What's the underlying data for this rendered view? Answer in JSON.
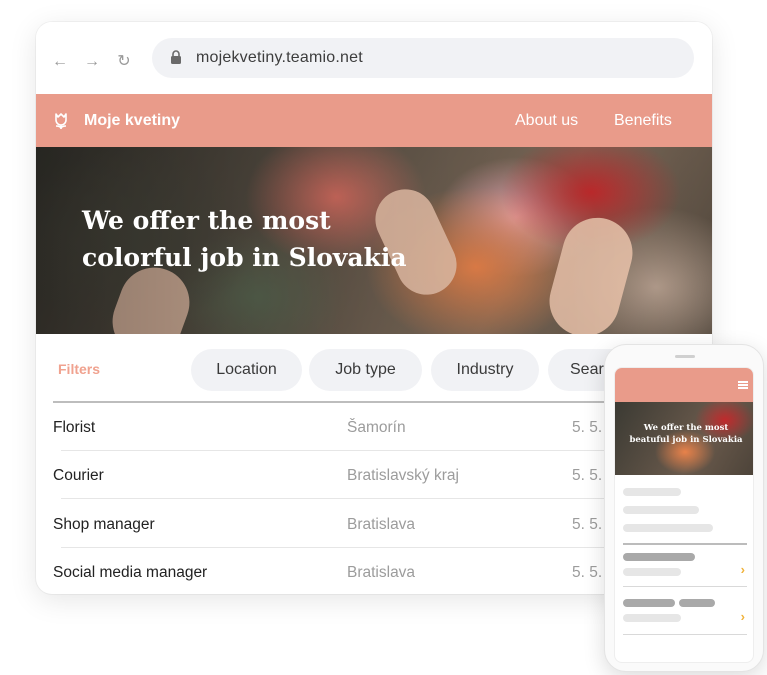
{
  "browser": {
    "url": "mojekvetiny.teamio.net",
    "icons": [
      "back-arrow-icon",
      "forward-arrow-icon",
      "reload-icon",
      "lock-icon"
    ]
  },
  "site": {
    "brand": "Moje kvetiny",
    "menu": [
      "About us",
      "Benefits"
    ],
    "hero_title_line1": "We offer the most",
    "hero_title_line2": "colorful job in Slovakia",
    "accent_color": "#e99b8a"
  },
  "filters": {
    "label": "Filters",
    "pills": [
      "Location",
      "Job type",
      "Industry",
      "Sear"
    ]
  },
  "jobs": [
    {
      "title": "Florist",
      "location": "Šamorín",
      "date": "5. 5."
    },
    {
      "title": "Courier",
      "location": "Bratislavský kraj",
      "date": "5. 5."
    },
    {
      "title": "Shop manager",
      "location": "Bratislava",
      "date": "5. 5."
    },
    {
      "title": "Social media manager",
      "location": "Bratislava",
      "date": "5. 5."
    }
  ],
  "mobile": {
    "hero_title": "We offer the most beatuful job in Slovakia",
    "chevron": "›"
  }
}
